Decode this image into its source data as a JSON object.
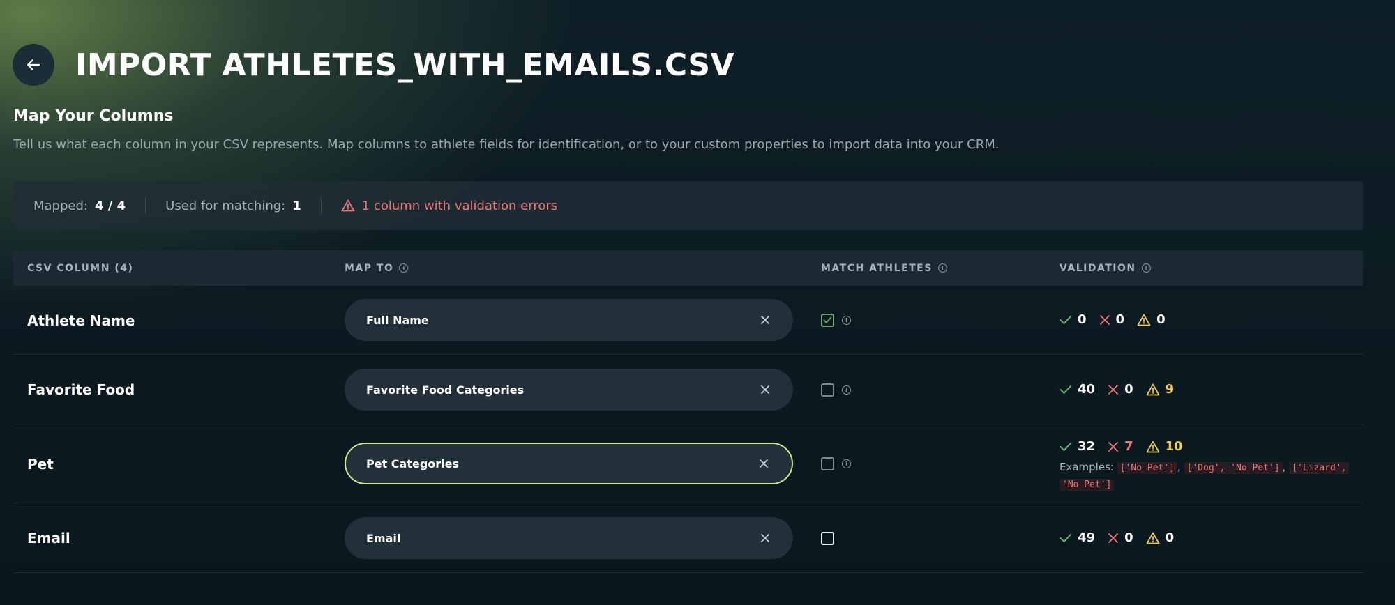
{
  "header": {
    "title": "IMPORT ATHLETES_WITH_EMAILS.CSV",
    "back_icon": "arrow-left-icon"
  },
  "section": {
    "title": "Map Your Columns",
    "description": "Tell us what each column in your CSV represents. Map columns to athlete fields for identification, or to your custom properties to import data into your CRM."
  },
  "summary": {
    "mapped_label": "Mapped:",
    "mapped_value": "4 / 4",
    "matching_label": "Used for matching:",
    "matching_value": "1",
    "error_text": "1 column with validation errors"
  },
  "table": {
    "headers": {
      "csv_column": "CSV COLUMN (4)",
      "map_to": "MAP TO",
      "match_athletes": "MATCH ATHLETES",
      "validation": "VALIDATION"
    },
    "rows": [
      {
        "name": "Athlete Name",
        "map_to": "Full Name",
        "match": true,
        "ok": "0",
        "err": "0",
        "warn": "0"
      },
      {
        "name": "Favorite Food",
        "map_to": "Favorite Food Categories",
        "match": false,
        "ok": "40",
        "err": "0",
        "warn": "9"
      },
      {
        "name": "Pet",
        "map_to": "Pet Categories",
        "match": false,
        "ok": "32",
        "err": "7",
        "warn": "10",
        "examples_label": "Examples:",
        "examples": [
          "['No Pet']",
          "['Dog', 'No Pet']",
          "['Lizard',",
          "'No Pet']"
        ]
      },
      {
        "name": "Email",
        "map_to": "Email",
        "match": false,
        "ok": "49",
        "err": "0",
        "warn": "0"
      }
    ]
  },
  "colors": {
    "success": "#6fbf73",
    "error": "#f07676",
    "warning": "#f2c94c",
    "active_border": "#c9e58f"
  }
}
